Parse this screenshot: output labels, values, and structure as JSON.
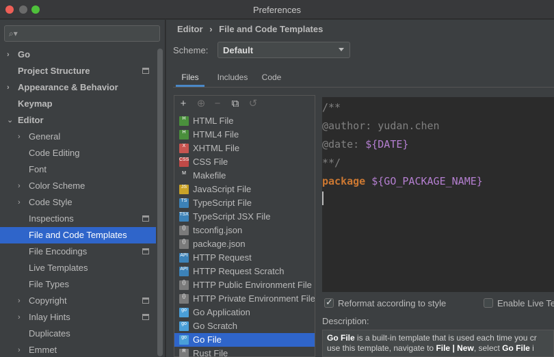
{
  "window": {
    "title": "Preferences"
  },
  "search": {
    "placeholder": ""
  },
  "sidebar": {
    "items": [
      {
        "label": "Go",
        "level": 0,
        "arrow": "›",
        "bold": true
      },
      {
        "label": "Project Structure",
        "level": 0,
        "bold": true,
        "badge": true
      },
      {
        "label": "Appearance & Behavior",
        "level": 0,
        "arrow": "›",
        "bold": true
      },
      {
        "label": "Keymap",
        "level": 0,
        "bold": true
      },
      {
        "label": "Editor",
        "level": 0,
        "arrow": "⌄",
        "bold": true
      },
      {
        "label": "General",
        "level": 1,
        "arrow": "›"
      },
      {
        "label": "Code Editing",
        "level": 1
      },
      {
        "label": "Font",
        "level": 1
      },
      {
        "label": "Color Scheme",
        "level": 1,
        "arrow": "›"
      },
      {
        "label": "Code Style",
        "level": 1,
        "arrow": "›"
      },
      {
        "label": "Inspections",
        "level": 1,
        "badge": true
      },
      {
        "label": "File and Code Templates",
        "level": 1,
        "selected": true
      },
      {
        "label": "File Encodings",
        "level": 1,
        "badge": true
      },
      {
        "label": "Live Templates",
        "level": 1
      },
      {
        "label": "File Types",
        "level": 1
      },
      {
        "label": "Copyright",
        "level": 1,
        "arrow": "›",
        "badge": true
      },
      {
        "label": "Inlay Hints",
        "level": 1,
        "arrow": "›",
        "badge": true
      },
      {
        "label": "Duplicates",
        "level": 1
      },
      {
        "label": "Emmet",
        "level": 1,
        "arrow": "›"
      }
    ]
  },
  "breadcrumb": {
    "part1": "Editor",
    "separator": "›",
    "part2": "File and Code Templates"
  },
  "scheme": {
    "label": "Scheme:",
    "value": "Default"
  },
  "tabs": [
    {
      "label": "Files",
      "active": true
    },
    {
      "label": "Includes"
    },
    {
      "label": "Code"
    }
  ],
  "toolbar": {
    "add": "+",
    "add_child": "⊕",
    "remove": "−",
    "copy": "⧉",
    "reset": "↺"
  },
  "templates": [
    {
      "label": "HTML File",
      "icon": "html-file-icon",
      "color": "#4a8f3c",
      "tag": "H"
    },
    {
      "label": "HTML4 File",
      "icon": "html-file-icon",
      "color": "#4a8f3c",
      "tag": "H"
    },
    {
      "label": "XHTML File",
      "icon": "xhtml-file-icon",
      "color": "#c75450",
      "tag": "X"
    },
    {
      "label": "CSS File",
      "icon": "css-file-icon",
      "color": "#c04a47",
      "tag": "CSS"
    },
    {
      "label": "Makefile",
      "icon": "makefile-icon",
      "color": "#3c3f41",
      "tag": "M"
    },
    {
      "label": "JavaScript File",
      "icon": "js-file-icon",
      "color": "#c9a227",
      "tag": "JS"
    },
    {
      "label": "TypeScript File",
      "icon": "ts-file-icon",
      "color": "#3c82b8",
      "tag": "TS"
    },
    {
      "label": "TypeScript JSX File",
      "icon": "tsx-file-icon",
      "color": "#3c82b8",
      "tag": "TSX"
    },
    {
      "label": "tsconfig.json",
      "icon": "json-file-icon",
      "color": "#7a7a7a",
      "tag": "{}"
    },
    {
      "label": "package.json",
      "icon": "json-file-icon",
      "color": "#7a7a7a",
      "tag": "{}"
    },
    {
      "label": "HTTP Request",
      "icon": "api-file-icon",
      "color": "#3c82b8",
      "tag": "API"
    },
    {
      "label": "HTTP Request Scratch",
      "icon": "api-file-icon",
      "color": "#3c82b8",
      "tag": "API"
    },
    {
      "label": "HTTP Public Environment File",
      "icon": "json-file-icon",
      "color": "#7a7a7a",
      "tag": "{}"
    },
    {
      "label": "HTTP Private Environment File",
      "icon": "json-file-icon",
      "color": "#7a7a7a",
      "tag": "{}"
    },
    {
      "label": "Go Application",
      "icon": "go-file-icon",
      "color": "#4a9fd8",
      "tag": "go"
    },
    {
      "label": "Go Scratch",
      "icon": "go-file-icon",
      "color": "#4a9fd8",
      "tag": "go"
    },
    {
      "label": "Go File",
      "icon": "go-file-icon",
      "color": "#4a9fd8",
      "tag": "go",
      "selected": true
    },
    {
      "label": "Rust File",
      "icon": "rust-file-icon",
      "color": "#7a7a7a",
      "tag": "R"
    }
  ],
  "editor": {
    "line1": "/**",
    "line2": "@author: yudan.chen",
    "line3_text": "@date: ",
    "line3_var": "${DATE}",
    "line4": "**/",
    "line5_kw": "package ",
    "line5_var": "${GO_PACKAGE_NAME}"
  },
  "options": {
    "reformat": {
      "label": "Reformat according to style",
      "checked": true
    },
    "live_templates": {
      "label": "Enable Live Te",
      "checked": false
    }
  },
  "description": {
    "label": "Description:",
    "line1_bold": "Go File",
    "line1_rest": " is a built-in template that is used each time you cr",
    "line2_a": "use this template, navigate to ",
    "line2_b1": "File | New",
    "line2_c": ", select ",
    "line2_b2": "Go File",
    "line2_d": " i"
  },
  "colors": {
    "accent": "#2f65ca",
    "tab_underline": "#4a88c7",
    "keyword": "#cc7832",
    "template_var": "#b57fd1"
  }
}
